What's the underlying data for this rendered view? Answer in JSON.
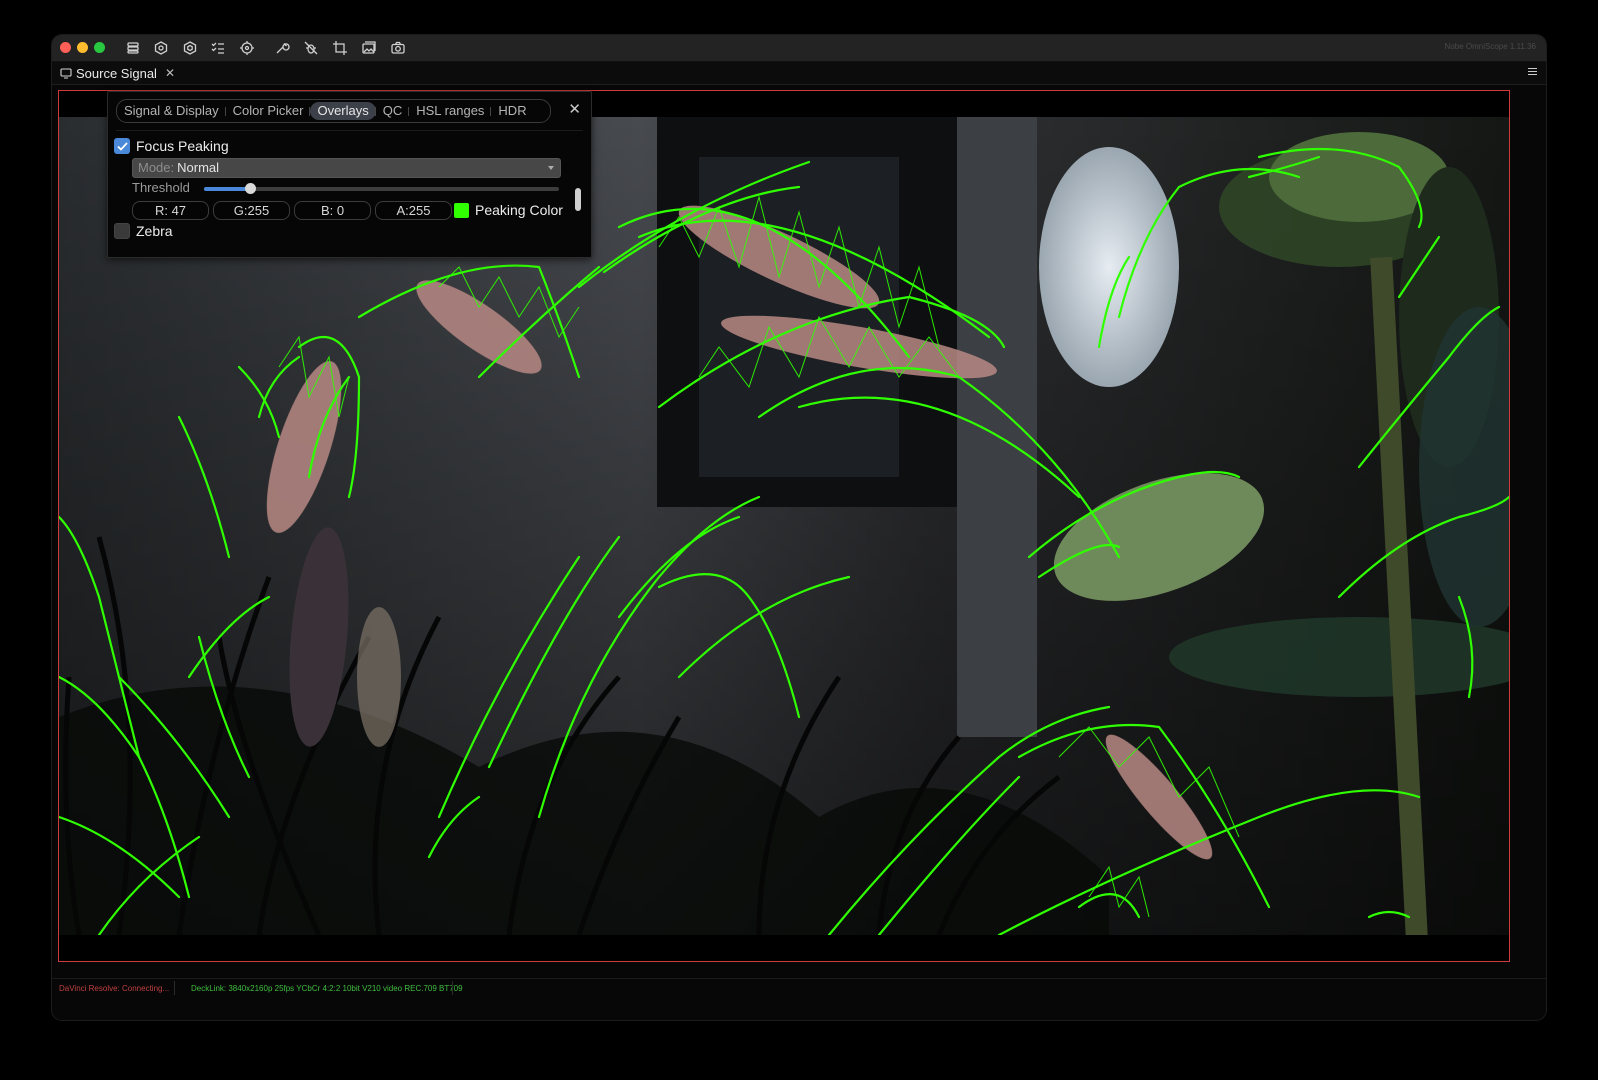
{
  "app": {
    "version": "Nobe OmniScope 1.11.36",
    "toolbar_icons": [
      "layers-icon",
      "hexagon-icon",
      "hexagon-gear-icon",
      "checklist-icon",
      "target-icon",
      "wrench-icon",
      "bug-off-icon",
      "crop-icon",
      "image-stack-icon",
      "camera-icon"
    ]
  },
  "tab": {
    "label": "Source Signal",
    "close": "✕",
    "icon": "monitor-icon"
  },
  "overlay_panel": {
    "tabs": [
      "Signal & Display",
      "Color Picker",
      "Overlays",
      "QC",
      "HSL ranges",
      "HDR"
    ],
    "active_tab": "Overlays",
    "close": "✕",
    "focus_peaking": {
      "label": "Focus Peaking",
      "checked": true
    },
    "mode": {
      "label": "Mode:",
      "value": "Normal"
    },
    "threshold": {
      "label": "Threshold",
      "value": 0.13
    },
    "rgba": [
      "R: 47",
      "G:255",
      "B:  0",
      "A:255"
    ],
    "peaking_color": {
      "label": "Peaking Color",
      "color": "#2fff00"
    },
    "zebra": {
      "label": "Zebra",
      "checked": false
    }
  },
  "status": {
    "resolve": "DaVinci Resolve: Connecting...",
    "decklink": "DeckLink: 3840x2160p 25fps YCbCr 4:2:2 10bit V210 video REC.709 BT709"
  },
  "colors": {
    "peaking": "#2fff00",
    "viewer_border": "#d13a3a",
    "accent": "#4a89d9",
    "status_error": "#c04040",
    "status_ok": "#3fbf3f"
  }
}
